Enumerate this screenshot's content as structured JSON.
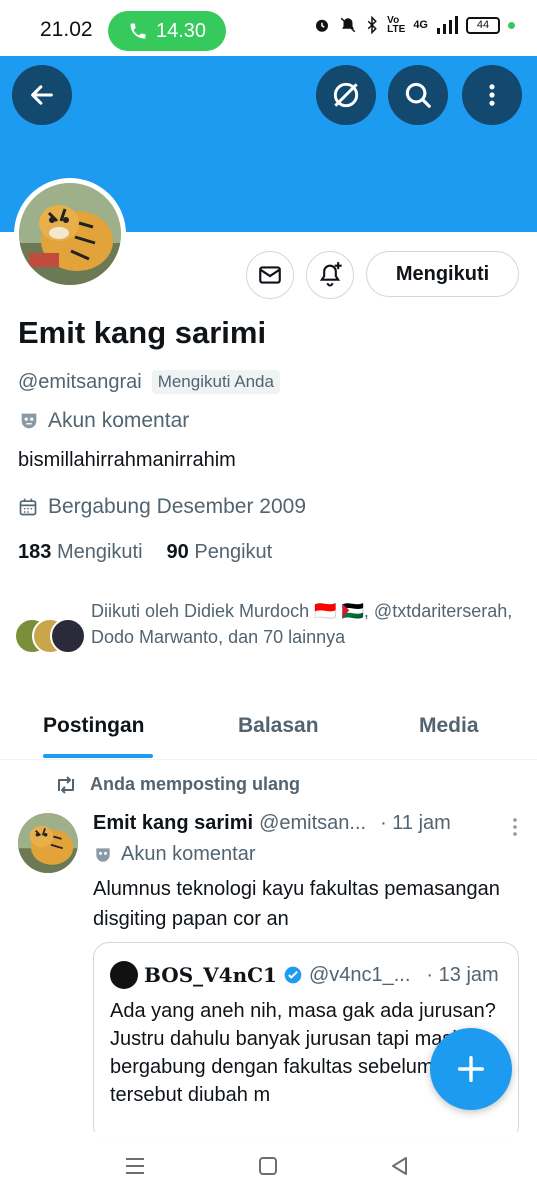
{
  "status_bar": {
    "time": "21.02",
    "call_timer": "14.30",
    "network": "4G",
    "battery": "44"
  },
  "header": {
    "back_icon": "arrow-left-icon",
    "mute_icon": "mute-icon",
    "search_icon": "search-icon",
    "more_icon": "more-vertical-icon"
  },
  "profile": {
    "name": "Emit kang sarimi",
    "handle": "@emitsangrai",
    "follows_you": "Mengikuti Anda",
    "automated_label": "Akun komentar",
    "bio": "bismillahirrahmanirrahim",
    "joined": "Bergabung Desember 2009",
    "following_count": "183",
    "following_label": "Mengikuti",
    "followers_count": "90",
    "followers_label": "Pengikut",
    "follow_button": "Mengikuti",
    "followed_by_text": "Diikuti oleh Didiek Murdoch 🇮🇩 🇵🇸, @txtdariterserah, Dodo Marwanto, dan 70 lainnya"
  },
  "tabs": [
    {
      "label": "Postingan",
      "active": true
    },
    {
      "label": "Balasan",
      "active": false
    },
    {
      "label": "Media",
      "active": false
    }
  ],
  "post": {
    "repost_label": "Anda memposting ulang",
    "author_name": "Emit kang sarimi",
    "author_handle": "@emitsan...",
    "time": "· 11 jam",
    "label": "Akun komentar",
    "text": "Alumnus teknologi kayu fakultas pemasangan disgiting papan cor an",
    "quote": {
      "author_name": "BOS_V4nC1",
      "author_handle": "@v4nc1_...",
      "time": "· 13 jam",
      "text": "Ada yang aneh nih, masa gak ada jurusan? Justru dahulu banyak jurusan tapi masih bergabung dengan fakultas sebelum jurusan tersebut diubah m"
    }
  },
  "colors": {
    "accent": "#1d9bf0",
    "header_button": "#13486f",
    "muted_text": "#536471",
    "call_green": "#36c95b"
  }
}
